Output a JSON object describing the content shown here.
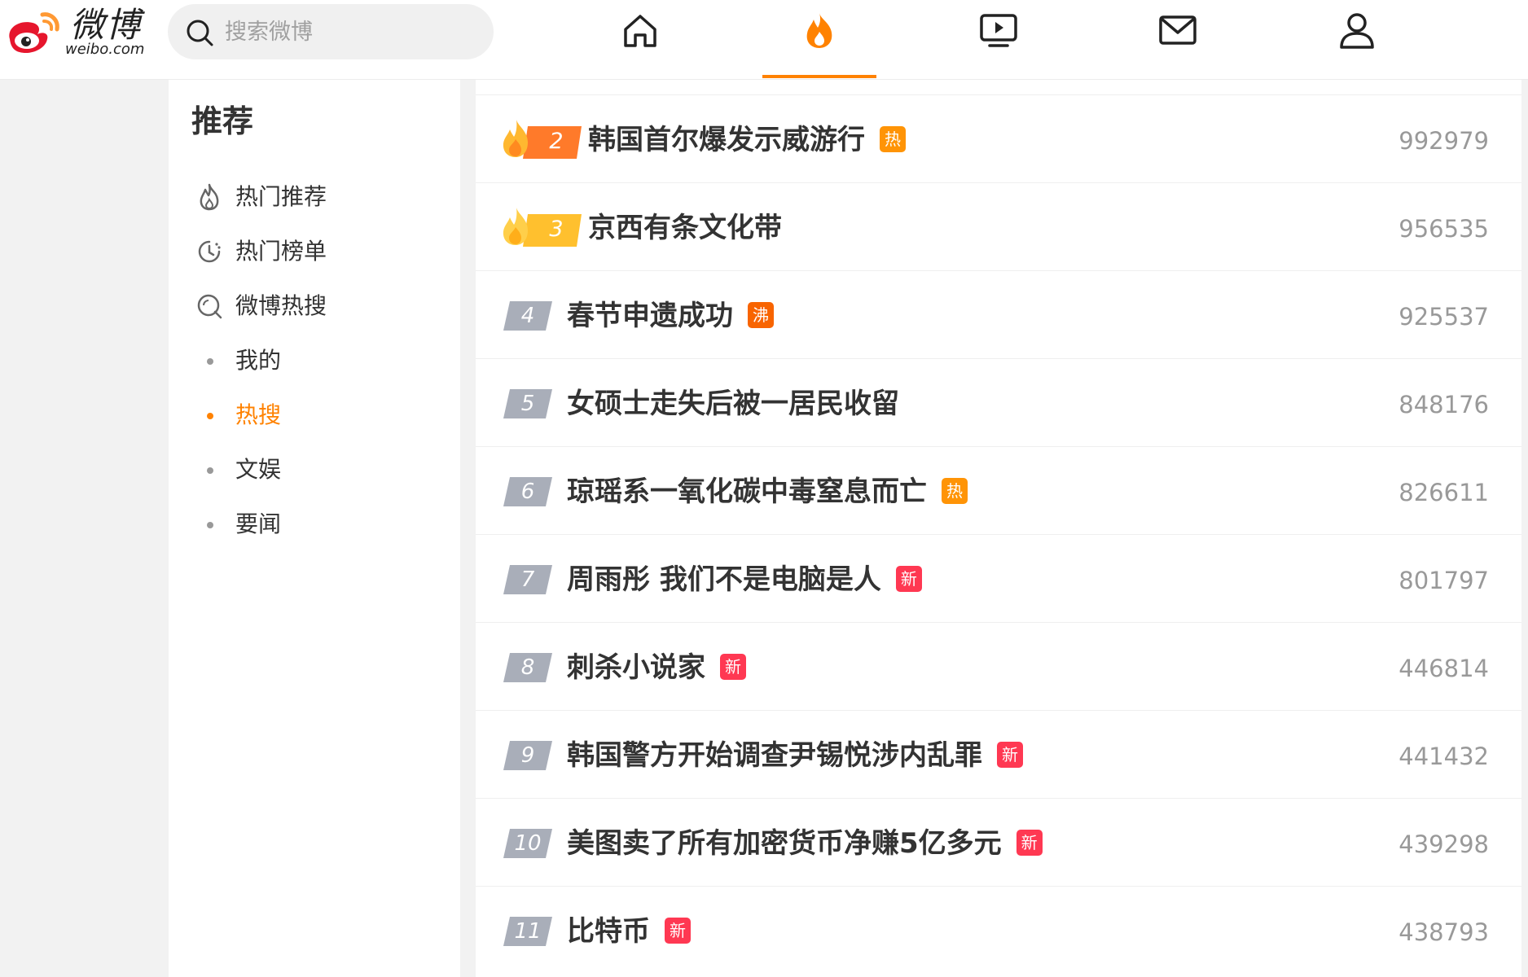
{
  "app": {
    "logo_text": "微博",
    "logo_sub": "weibo.com"
  },
  "search": {
    "placeholder": "搜索微博"
  },
  "nav": [
    {
      "name": "home-icon"
    },
    {
      "name": "fire-icon",
      "active": true
    },
    {
      "name": "video-icon"
    },
    {
      "name": "mail-icon"
    },
    {
      "name": "user-icon"
    }
  ],
  "sidebar": {
    "title": "推荐",
    "items": [
      {
        "label": "热门推荐",
        "icon": "fire-outline-icon"
      },
      {
        "label": "热门榜单",
        "icon": "clock-icon"
      },
      {
        "label": "微博热搜",
        "icon": "search-circle-icon"
      },
      {
        "label": "我的",
        "icon": "bullet"
      },
      {
        "label": "热搜",
        "icon": "bullet",
        "active": true
      },
      {
        "label": "文娱",
        "icon": "bullet"
      },
      {
        "label": "要闻",
        "icon": "bullet"
      }
    ]
  },
  "colors": {
    "accent": "#ff8200",
    "badge_hot": "#ff9406",
    "badge_boil": "#f86400",
    "badge_new": "#ff3852",
    "rank_gray": "#a9aeb9",
    "rank2": "#ff7a2a",
    "rank3": "#ffc02e"
  },
  "hotlist": [
    {
      "rank": "2",
      "title": "韩国首尔爆发示威游行",
      "badge": "热",
      "hot": "992979"
    },
    {
      "rank": "3",
      "title": "京西有条文化带",
      "badge": "",
      "hot": "956535"
    },
    {
      "rank": "4",
      "title": "春节申遗成功",
      "badge": "沸",
      "hot": "925537"
    },
    {
      "rank": "5",
      "title": "女硕士走失后被一居民收留",
      "badge": "",
      "hot": "848176"
    },
    {
      "rank": "6",
      "title": "琼瑶系一氧化碳中毒窒息而亡",
      "badge": "热",
      "hot": "826611"
    },
    {
      "rank": "7",
      "title": "周雨彤 我们不是电脑是人",
      "badge": "新",
      "hot": "801797"
    },
    {
      "rank": "8",
      "title": "刺杀小说家",
      "badge": "新",
      "hot": "446814"
    },
    {
      "rank": "9",
      "title": "韩国警方开始调查尹锡悦涉内乱罪",
      "badge": "新",
      "hot": "441432"
    },
    {
      "rank": "10",
      "title": "美图卖了所有加密货币净赚5亿多元",
      "badge": "新",
      "hot": "439298"
    },
    {
      "rank": "11",
      "title": "比特币",
      "badge": "新",
      "hot": "438793"
    }
  ]
}
